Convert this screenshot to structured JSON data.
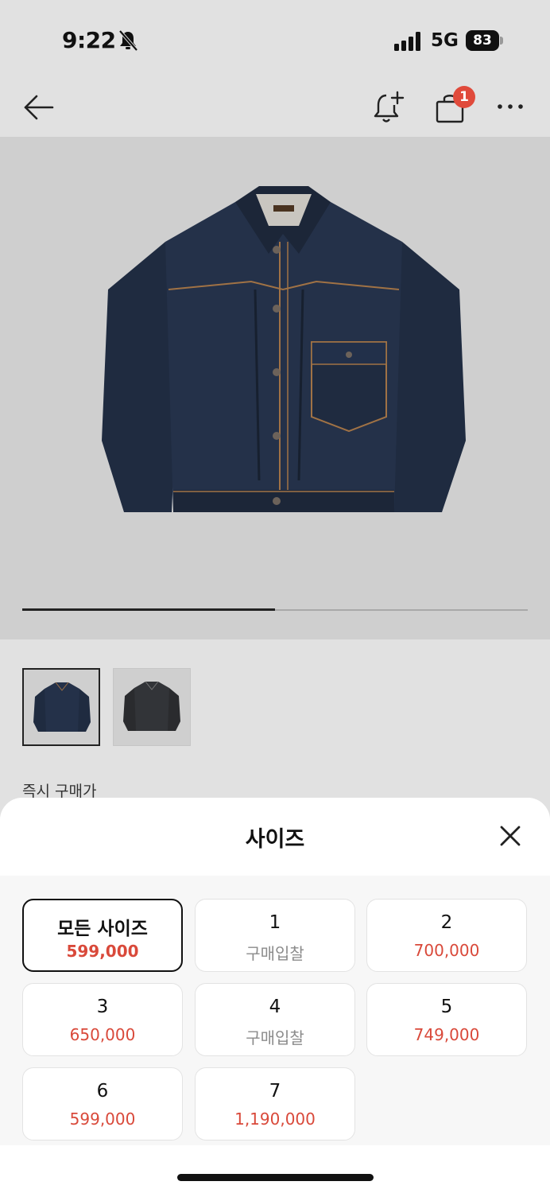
{
  "status_bar": {
    "time": "9:22",
    "network": "5G",
    "battery": "83",
    "icons": [
      "bell-mute-icon",
      "signal-icon",
      "battery-icon"
    ]
  },
  "nav": {
    "icons": [
      "back-arrow-icon",
      "bell-add-icon",
      "shopping-bag-icon",
      "more-icon"
    ],
    "cart_badge": "1"
  },
  "gallery": {
    "progress": 0.5,
    "thumbnails": [
      "jacket-indigo",
      "jacket-black"
    ],
    "selected_index": 0
  },
  "instant_price_label": "즉시 구매가",
  "sheet": {
    "title": "사이즈",
    "close_icon": "close-icon",
    "sizes": [
      {
        "label": "모든 사이즈",
        "price": "599,000",
        "selected": true
      },
      {
        "label": "1",
        "price": "구매입찰",
        "bid": true
      },
      {
        "label": "2",
        "price": "700,000"
      },
      {
        "label": "3",
        "price": "650,000"
      },
      {
        "label": "4",
        "price": "구매입찰",
        "bid": true
      },
      {
        "label": "5",
        "price": "749,000"
      },
      {
        "label": "6",
        "price": "599,000"
      },
      {
        "label": "7",
        "price": "1,190,000"
      }
    ]
  },
  "colors": {
    "accent_red": "#d9493a",
    "badge_red": "#e04a3b",
    "background": "#e1e1e1"
  }
}
